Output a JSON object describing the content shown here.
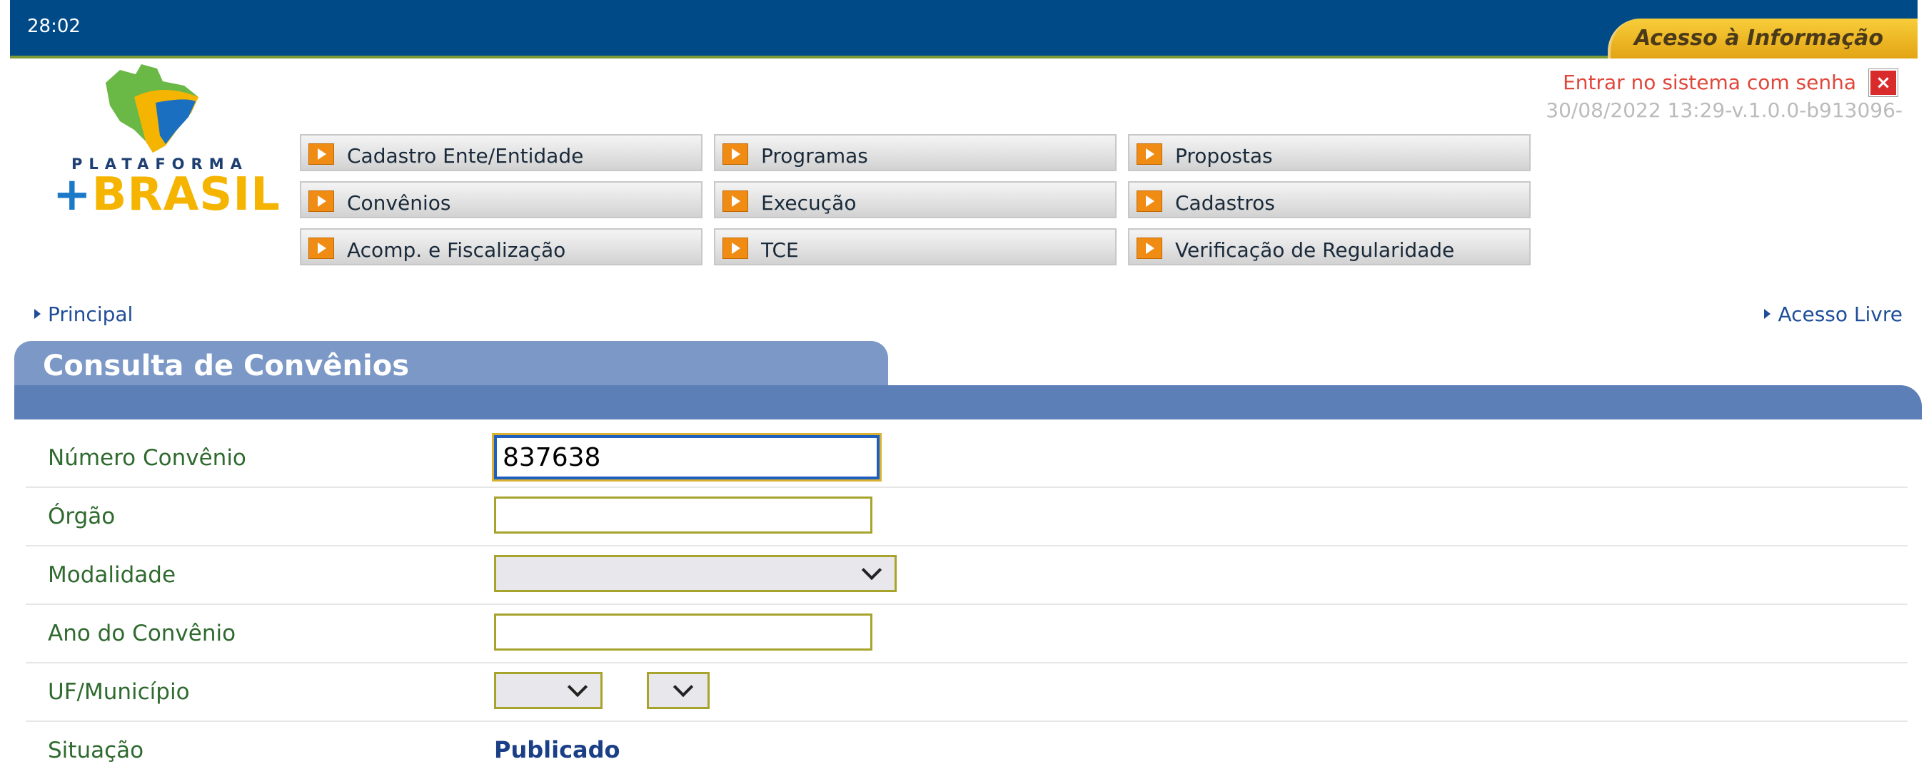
{
  "header": {
    "timer": "28:02",
    "acesso_tab": "Acesso à Informação",
    "login_link": "Entrar no sistema com senha",
    "version": "30/08/2022 13:29-v.1.0.0-b913096-"
  },
  "logo": {
    "line1": "PLATAFORMA",
    "plus": "+",
    "line2": "BRASIL"
  },
  "menu": {
    "items": [
      {
        "label": "Cadastro Ente/Entidade"
      },
      {
        "label": "Programas"
      },
      {
        "label": "Propostas"
      },
      {
        "label": "Convênios"
      },
      {
        "label": "Execução"
      },
      {
        "label": "Cadastros"
      },
      {
        "label": "Acomp. e Fiscalização"
      },
      {
        "label": "TCE"
      },
      {
        "label": "Verificação de Regularidade"
      }
    ]
  },
  "nav": {
    "principal": "Principal",
    "acesso_livre": "Acesso Livre"
  },
  "panel": {
    "title": "Consulta de Convênios"
  },
  "form": {
    "numero_label": "Número Convênio",
    "numero_value": "837638",
    "orgao_label": "Órgão",
    "orgao_value": "",
    "modalidade_label": "Modalidade",
    "modalidade_value": "",
    "ano_label": "Ano do Convênio",
    "ano_value": "",
    "uf_label": "UF/Município",
    "situacao_label": "Situação",
    "situacao_value": "Publicado"
  },
  "colors": {
    "topbar": "#004a87",
    "accent_orange": "#f08b13",
    "panel_blue": "#5b7fb6",
    "label_green": "#2f6a2f",
    "field_border": "#a7a32c"
  }
}
